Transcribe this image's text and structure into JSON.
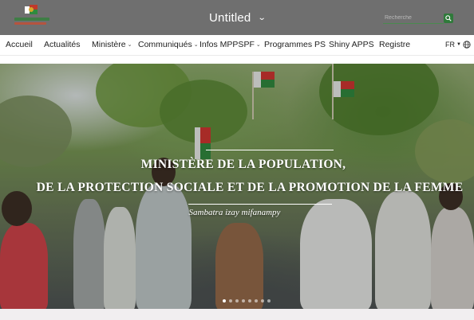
{
  "header": {
    "title": "Untitled",
    "search_placeholder": "Recherche",
    "logo_icon": "ministry-logo",
    "colors": {
      "bar": "#6f6f6f",
      "accent": "#2f7a3a"
    }
  },
  "nav": {
    "items": [
      {
        "label": "Accueil",
        "has_dropdown": false
      },
      {
        "label": "Actualités",
        "has_dropdown": false
      },
      {
        "label": "Ministère",
        "has_dropdown": true
      },
      {
        "label": "Communiqués",
        "has_dropdown": true
      },
      {
        "label": "Infos MPPSPF",
        "has_dropdown": true
      },
      {
        "label": "Programmes PS",
        "has_dropdown": false
      },
      {
        "label": "Shiny APPS",
        "has_dropdown": false
      },
      {
        "label": "Registre",
        "has_dropdown": false
      }
    ],
    "language": "FR"
  },
  "hero": {
    "line1": "MINISTÈRE DE LA POPULATION,",
    "line2": "DE LA PROTECTION SOCIALE ET DE LA PROMOTION DE LA FEMME",
    "tagline": "Sambatra izay mifanampy",
    "slide_count": 8,
    "active_slide": 1
  }
}
